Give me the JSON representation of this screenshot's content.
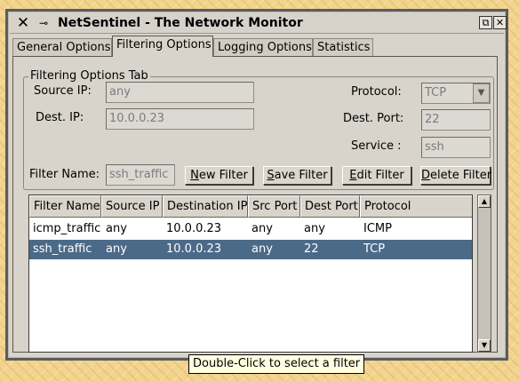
{
  "window": {
    "title": "NetSentinel - The Network Monitor",
    "icons": {
      "menu": "x-logo-icon",
      "pin": "pin-icon",
      "restore": "restore-icon",
      "close": "close-icon"
    }
  },
  "tabs": [
    {
      "label": "General Options"
    },
    {
      "label": "Filtering Options"
    },
    {
      "label": "Logging Options"
    },
    {
      "label": "Statistics"
    }
  ],
  "group": {
    "title": "Filtering Options Tab"
  },
  "form": {
    "source_ip_label": "Source IP:",
    "source_ip_value": "any",
    "dest_ip_label": "Dest. IP:",
    "dest_ip_value": "10.0.0.23",
    "protocol_label": "Protocol:",
    "protocol_value": "TCP",
    "dest_port_label": "Dest. Port:",
    "dest_port_value": "22",
    "service_label": "Service :",
    "service_value": "ssh",
    "filter_name_label": "Filter Name:",
    "filter_name_value": "ssh_traffic"
  },
  "buttons": {
    "new_u": "N",
    "new_rest": "ew Filter",
    "save_u": "S",
    "save_rest": "ave Filter",
    "edit_u": "E",
    "edit_rest": "dit Filter",
    "delete_u": "D",
    "delete_rest": "elete Filter"
  },
  "table": {
    "columns": [
      "Filter Name",
      "Source IP",
      "Destination IP",
      "Src Port",
      "Dest Port",
      "Protocol"
    ],
    "rows": [
      [
        "icmp_traffic",
        "any",
        "10.0.0.23",
        "any",
        "any",
        "ICMP"
      ],
      [
        "ssh_traffic",
        "any",
        "10.0.0.23",
        "any",
        "22",
        "TCP"
      ]
    ],
    "selected_row": 1
  },
  "tooltip": "Double-Click to select a filter",
  "colors": {
    "selection": "#4b6a88",
    "tooltip_bg": "#fffee0",
    "desktop": "#f3d48e"
  }
}
